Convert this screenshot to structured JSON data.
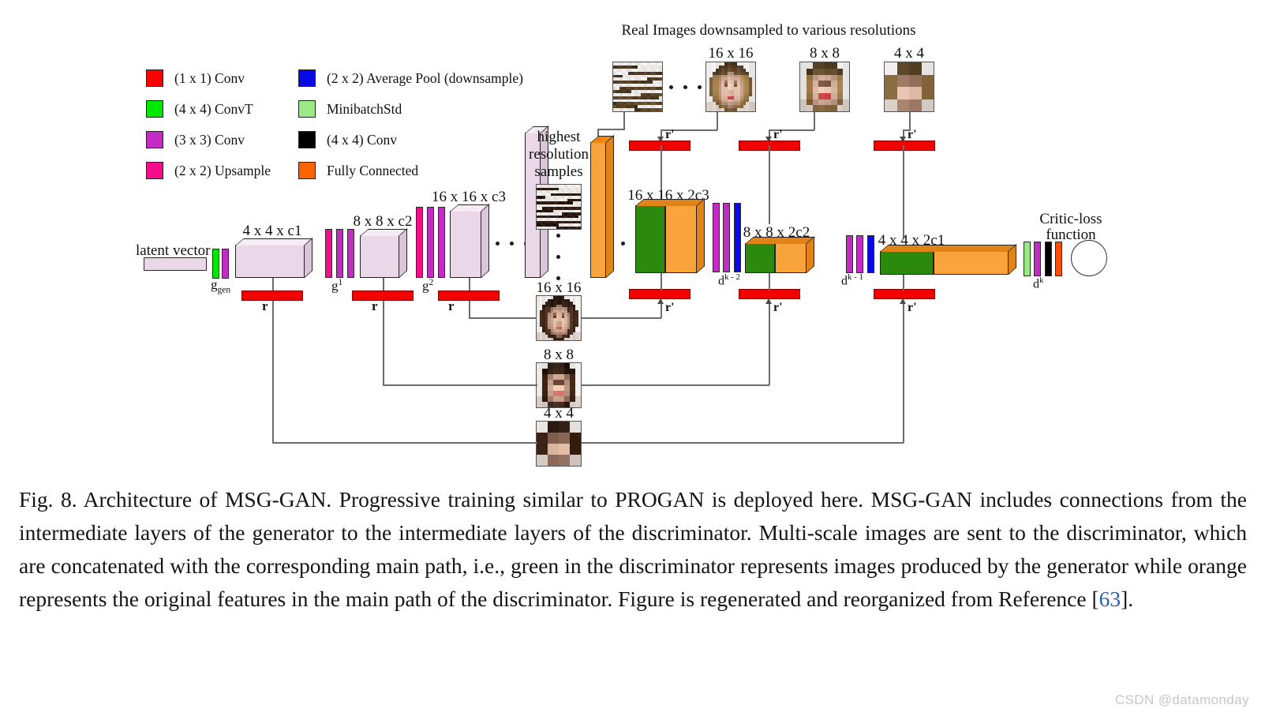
{
  "figure": {
    "title_top": "Real Images downsampled to various resolutions",
    "legend": [
      {
        "color": "#ff0000",
        "label": "(1 x 1) Conv"
      },
      {
        "color": "#00e800",
        "label": "(4 x 4) ConvT"
      },
      {
        "color": "#c42ac4",
        "label": "(3 x 3) Conv"
      },
      {
        "color": "#f50d8c",
        "label": "(2 x 2) Upsample"
      },
      {
        "color": "#0909e8",
        "label": "(2 x 2) Average Pool (downsample)"
      },
      {
        "color": "#9be887",
        "label": "MinibatchStd"
      },
      {
        "color": "#000000",
        "label": "(4 x 4) Conv"
      },
      {
        "color": "#fa6400",
        "label": "Fully Connected"
      }
    ],
    "generator": {
      "latent_label": "latent vector",
      "g_gen_label": "g",
      "g_gen_sub": "gen",
      "blocks": [
        {
          "label": "4 x 4 x c1",
          "tag": "r"
        },
        {
          "label": "8 x 8 x c2",
          "tag": "r"
        },
        {
          "label": "16 x 16 x c3",
          "tag": "r"
        }
      ],
      "stage_labels": [
        "g",
        "g"
      ],
      "stage_sups": [
        "1",
        "2"
      ],
      "highest_res_label": "highest\nresolution\nsamples",
      "highest_res_line1": "highest",
      "highest_res_line2": "resolution",
      "highest_res_line3": "samples"
    },
    "real_images": [
      {
        "caption": ""
      },
      {
        "caption": "16 x 16"
      },
      {
        "caption": "8 x 8"
      },
      {
        "caption": "4 x 4"
      }
    ],
    "generated_images": [
      {
        "caption": "16 x 16"
      },
      {
        "caption": "8 x 8"
      },
      {
        "caption": "4 x 4"
      }
    ],
    "discriminator": {
      "blocks": [
        {
          "label": "16 x 16 x 2c3",
          "tag": "d",
          "sup": "k - 2"
        },
        {
          "label": "8 x 8 x 2c2",
          "tag": "d",
          "sup": "k - 1"
        },
        {
          "label": "4 x 4 x 2c1",
          "tag": "d",
          "sup": "k"
        }
      ],
      "critic_line1": "Critic-loss",
      "critic_line2": "function"
    },
    "edge_label_gen": "r",
    "edge_label_disc": "r'"
  },
  "caption": {
    "text": "Fig. 8.  Architecture of MSG-GAN. Progressive training similar to PROGAN is deployed here. MSG-GAN includes connections from the intermediate layers of the generator to the intermediate layers of the discriminator. Multi-scale images are sent to the discriminator, which are concatenated with the corresponding main path, i.e., green in the discriminator represents images produced by the generator while orange represents the original features in the main path of the discriminator. Figure is regenerated and reorganized from Reference [",
    "ref": "63",
    "text_end": "]."
  },
  "watermark": "CSDN @datamonday",
  "colors": {
    "conv1x1": "#ff0000",
    "convT4x4": "#00e800",
    "conv3x3": "#c42ac4",
    "upsample2x2": "#f50d8c",
    "avgpool2x2": "#0909e8",
    "minibatchstd": "#9be887",
    "conv4x4": "#000000",
    "fully_connected": "#fa6400",
    "feature_block": "#ead8e8",
    "gen_concat_green": "#2b8a0e",
    "disc_main_orange": "#f29a30",
    "link_color": "#6b6b6b",
    "reference_link": "#2f5fa8"
  }
}
